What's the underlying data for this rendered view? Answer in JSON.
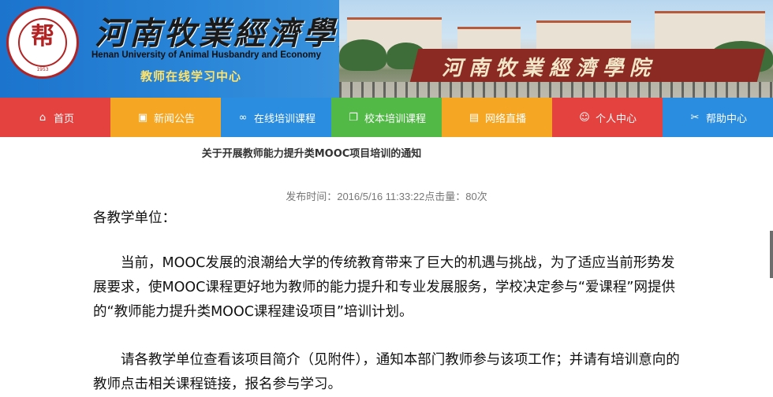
{
  "header": {
    "seal_glyph": "帮",
    "seal_ring_text": "1953",
    "title_cn": "河南牧業經濟學院",
    "title_en": "Henan University of Animal Husbandry and Economy",
    "subtitle": "教师在线学习中心",
    "photo_wall_text": "河南牧業經濟學院"
  },
  "nav": {
    "items": [
      {
        "icon": "home-icon",
        "glyph": "⌂",
        "label": "首页"
      },
      {
        "icon": "news-icon",
        "glyph": "▣",
        "label": "新闻公告"
      },
      {
        "icon": "link-icon",
        "glyph": "∞",
        "label": "在线培训课程"
      },
      {
        "icon": "copy-icon",
        "glyph": "❐",
        "label": "校本培训课程"
      },
      {
        "icon": "live-icon",
        "glyph": "▤",
        "label": "网络直播"
      },
      {
        "icon": "user-icon",
        "glyph": "☺",
        "label": "个人中心"
      },
      {
        "icon": "tools-icon",
        "glyph": "✂",
        "label": "帮助中心"
      }
    ]
  },
  "article": {
    "title": "关于开展教师能力提升类MOOC项目培训的通知",
    "meta": "发布时间：2016/5/16 11:33:22点击量：80次",
    "salutation": "各教学单位：",
    "paragraph1": "当前，MOOC发展的浪潮给大学的传统教育带来了巨大的机遇与挑战，为了适应当前形势发展要求，使MOOC课程更好地为教师的能力提升和专业发展服务，学校决定参与“爱课程”网提供的“教师能力提升类MOOC课程建设项目”培训计划。",
    "paragraph2": "请各教学单位查看该项目简介（见附件），通知本部门教师参与该项工作；并请有培训意向的教师点击相关课程链接，报名参与学习。"
  },
  "colors": {
    "nav_red": "#e4423f",
    "nav_orange": "#f5a623",
    "nav_blue": "#2a8de0",
    "nav_green": "#52b947",
    "banner_blue": "#1c74cc",
    "subtitle_yellow": "#ffe36b"
  }
}
